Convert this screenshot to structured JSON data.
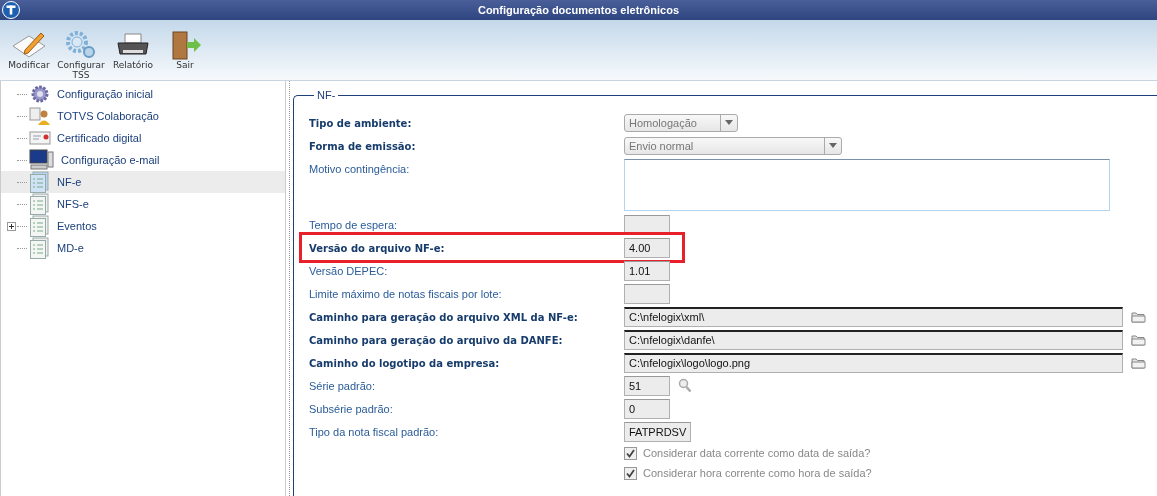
{
  "window": {
    "title": "Configuração documentos eletrônicos"
  },
  "toolbar": [
    {
      "label": "Modificar",
      "kind": "edit"
    },
    {
      "label": "Configurar TSS",
      "kind": "gears"
    },
    {
      "label": "Relatório",
      "kind": "printer"
    },
    {
      "label": "Sair",
      "kind": "exit"
    }
  ],
  "tree": [
    {
      "label": "Configuração inicial",
      "kind": "gear",
      "selected": false
    },
    {
      "label": "TOTVS Colaboração",
      "kind": "people",
      "selected": false
    },
    {
      "label": "Certificado digital",
      "kind": "certificate",
      "selected": false
    },
    {
      "label": "Configuração e-mail",
      "kind": "computer",
      "selected": false
    },
    {
      "label": "NF-e",
      "kind": "document",
      "selected": true
    },
    {
      "label": "NFS-e",
      "kind": "document",
      "selected": false
    },
    {
      "label": "Eventos",
      "kind": "document",
      "selected": false,
      "expanded": false
    },
    {
      "label": "MD-e",
      "kind": "document",
      "selected": false
    }
  ],
  "form": {
    "legend": "NF-",
    "fields": [
      {
        "label": "Tipo de ambiente:",
        "bold": true,
        "kind": "select",
        "value": "Homologação"
      },
      {
        "label": "Forma de emissão:",
        "bold": true,
        "kind": "select",
        "value": "Envio normal"
      },
      {
        "label": "Motivo contingência:",
        "bold": false,
        "kind": "textarea"
      },
      {
        "label": "Tempo de espera:",
        "bold": false,
        "kind": "text"
      },
      {
        "label": "Versão do arquivo NF-e:",
        "bold": true,
        "kind": "text",
        "value": "4.00",
        "highlighted": true
      },
      {
        "label": "Versão DEPEC:",
        "bold": false,
        "kind": "text",
        "value": "1.01"
      },
      {
        "label": "Limite máximo de notas fiscais por lote:",
        "bold": false,
        "kind": "text"
      },
      {
        "label": "Caminho para geração do arquivo XML da NF-e:",
        "bold": true,
        "kind": "path",
        "value": "C:\\nfelogix\\xml\\"
      },
      {
        "label": "Caminho para geração do arquivo da DANFE:",
        "bold": true,
        "kind": "path",
        "value": "C:\\nfelogix\\danfe\\"
      },
      {
        "label": "Caminho do logotipo da empresa:",
        "bold": true,
        "kind": "path",
        "value": "C:\\nfelogix\\logo\\logo.png"
      },
      {
        "label": "Série padrão:",
        "bold": false,
        "kind": "lookup",
        "value": "51"
      },
      {
        "label": "Subsérie padrão:",
        "bold": false,
        "kind": "text",
        "value": "0"
      },
      {
        "label": "Tipo da nota fiscal padrão:",
        "bold": false,
        "kind": "text",
        "value": "FATPRDSV"
      },
      {
        "label": "Considerar data corrente como data de saída?",
        "kind": "checkbox",
        "checked": true
      },
      {
        "label": "Considerar hora corrente como hora de saída?",
        "kind": "checkbox",
        "checked": true
      }
    ]
  }
}
